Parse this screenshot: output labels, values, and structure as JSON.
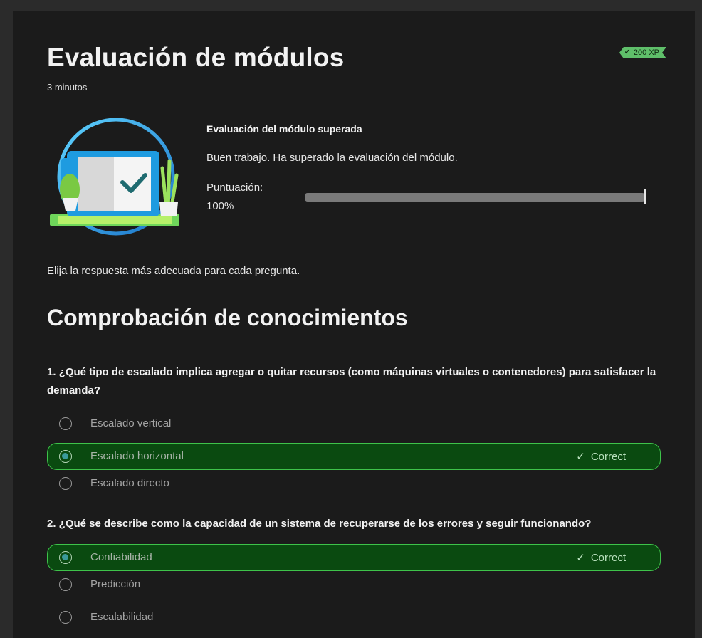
{
  "header": {
    "title": "Evaluación de módulos",
    "duration": "3 minutos",
    "xp_badge": "200 XP"
  },
  "result": {
    "heading": "Evaluación del módulo superada",
    "message": "Buen trabajo. Ha superado la evaluación del módulo.",
    "score_label": "Puntuación:",
    "score_value": "100%",
    "score_fraction": 1.0
  },
  "instructions": "Elija la respuesta más adecuada para cada pregunta.",
  "section_title": "Comprobación de conocimientos",
  "correct_label": "Correct",
  "questions": [
    {
      "text": "1. ¿Qué tipo de escalado implica agregar o quitar recursos (como máquinas virtuales o contenedores) para satisfacer la demanda?",
      "options": [
        "Escalado vertical",
        "Escalado horizontal",
        "Escalado directo"
      ],
      "selected_index": 1
    },
    {
      "text": "2. ¿Qué se describe como la capacidad de un sistema de recuperarse de los errores y seguir funcionando?",
      "options": [
        "Confiabilidad",
        "Predicción",
        "Escalabilidad"
      ],
      "selected_index": 0
    }
  ],
  "colors": {
    "correct_bg": "#0a4a10",
    "correct_border": "#3ec34a",
    "xp_badge": "#5fbf6a"
  }
}
